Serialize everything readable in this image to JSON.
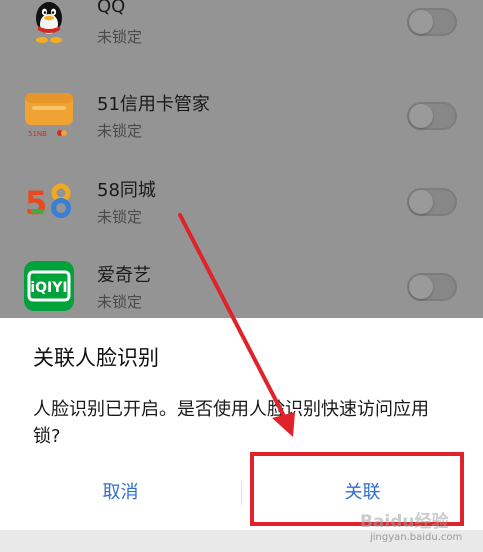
{
  "apps": [
    {
      "name": "QQ",
      "status": "未锁定",
      "icon": "qq-penguin-icon"
    },
    {
      "name": "51信用卡管家",
      "status": "未锁定",
      "icon": "credit-card-manager-icon"
    },
    {
      "name": "58同城",
      "status": "未锁定",
      "icon": "58-city-icon"
    },
    {
      "name": "爱奇艺",
      "status": "未锁定",
      "icon": "iqiyi-icon",
      "icon_text": "iQIYI"
    }
  ],
  "dialog": {
    "title": "关联人脸识别",
    "message": "人脸识别已开启。是否使用人脸识别快速访问应用锁?",
    "cancel_label": "取消",
    "confirm_label": "关联"
  },
  "watermark": {
    "text": "Baidu经验",
    "url": "jingyan.baidu.com"
  },
  "colors": {
    "dim_background": "#949494",
    "dialog_button": "#2f6fd0",
    "annotation_red": "#e0222a"
  }
}
